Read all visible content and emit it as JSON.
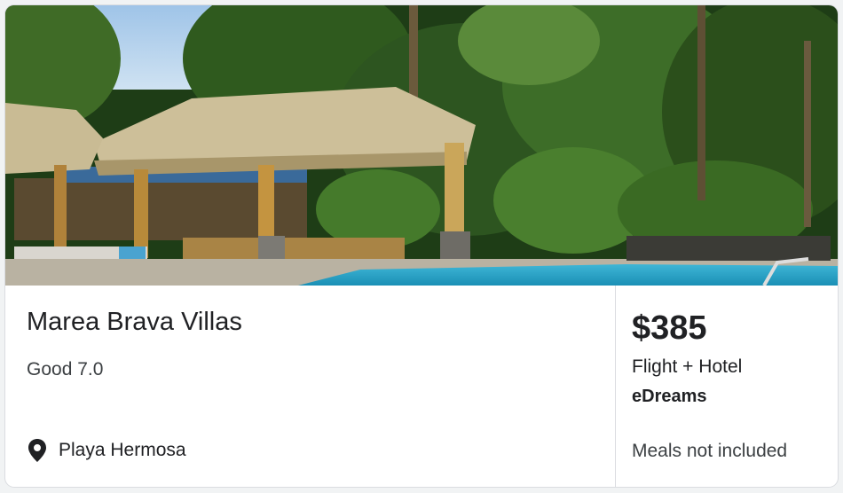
{
  "hotel": {
    "name": "Marea Brava Villas",
    "rating": "Good 7.0",
    "location": "Playa Hermosa"
  },
  "offer": {
    "price": "$385",
    "package": "Flight + Hotel",
    "provider": "eDreams",
    "meals": "Meals not included"
  },
  "icons": {
    "location": "map-pin-icon"
  },
  "colors": {
    "text": "#202124",
    "secondary": "#3c4043",
    "divider": "#dadce0",
    "pool": "#2aa3c7"
  }
}
